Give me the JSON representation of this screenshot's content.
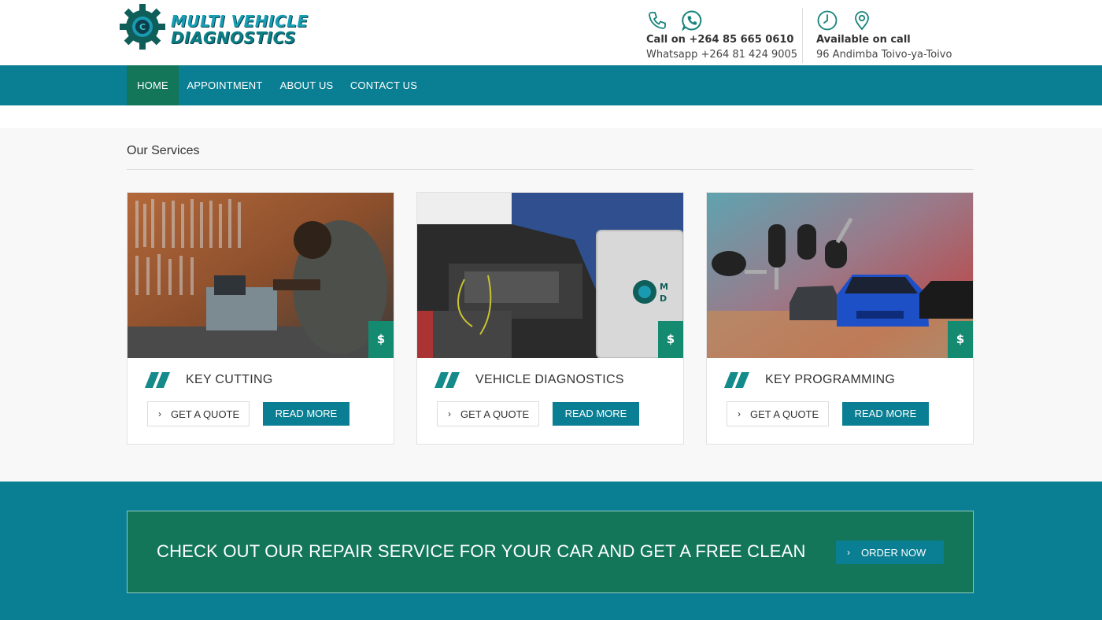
{
  "brand": {
    "logo_line1": "MULTI VEHICLE",
    "logo_line2": "DIAGNOSTICS",
    "colors": {
      "primary": "#0a7e92",
      "secondary": "#137659",
      "accent": "#148a70"
    }
  },
  "header": {
    "phone": {
      "icons": [
        "phone-icon",
        "whatsapp-icon"
      ],
      "line1": "Call on +264 85 665 0610",
      "line2": "Whatsapp +264 81 424 9005"
    },
    "availability": {
      "icons": [
        "clock-icon",
        "location-pin-icon"
      ],
      "line1": "Available on call",
      "line2": "96 Andimba Toivo-ya-Toivo"
    }
  },
  "nav": {
    "items": [
      {
        "label": "HOME",
        "active": true
      },
      {
        "label": "APPOINTMENT",
        "active": false
      },
      {
        "label": "ABOUT US",
        "active": false
      },
      {
        "label": "CONTACT US",
        "active": false
      }
    ]
  },
  "services": {
    "title": "Our Services",
    "cards": [
      {
        "title": "KEY CUTTING",
        "price_symbol": "$",
        "quote_label": "GET A QUOTE",
        "read_label": "READ MORE"
      },
      {
        "title": "VEHICLE DIAGNOSTICS",
        "price_symbol": "$",
        "quote_label": "GET A QUOTE",
        "read_label": "READ MORE"
      },
      {
        "title": "KEY PROGRAMMING",
        "price_symbol": "$",
        "quote_label": "GET A QUOTE",
        "read_label": "READ MORE"
      }
    ]
  },
  "promo": {
    "text": "CHECK OUT OUR REPAIR SERVICE FOR YOUR CAR AND GET A FREE CLEAN",
    "button_label": "ORDER NOW"
  }
}
